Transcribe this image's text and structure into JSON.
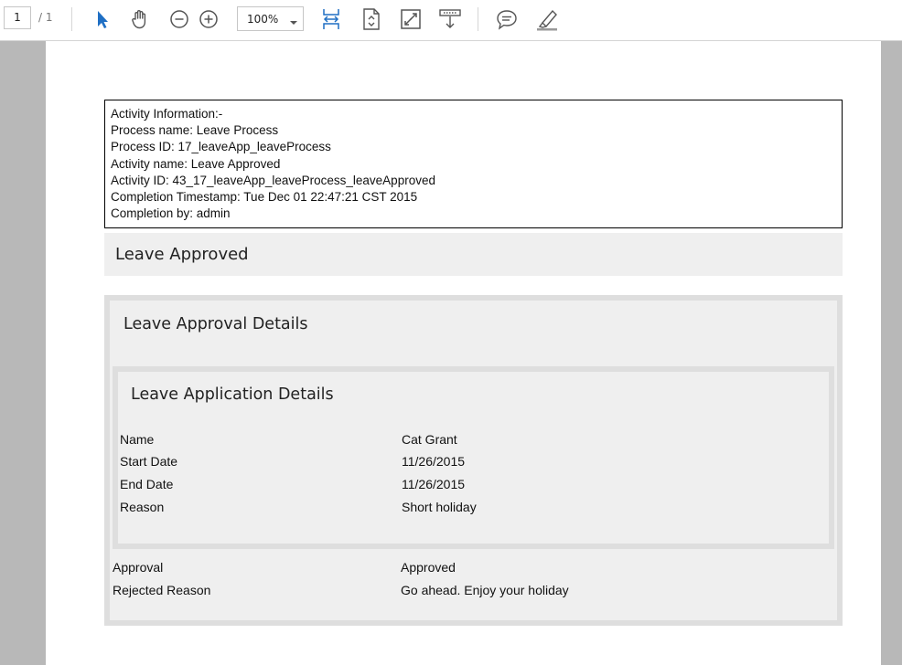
{
  "toolbar": {
    "page_current": "1",
    "page_total": "/ 1",
    "zoom": "100%",
    "icons": [
      "select-arrow-icon",
      "hand-pan-icon",
      "zoom-out-icon",
      "zoom-in-icon",
      "fit-width-icon",
      "fit-page-icon",
      "full-screen-icon",
      "download-icon",
      "comment-icon",
      "highlight-pen-icon"
    ]
  },
  "info": {
    "lines": [
      "Activity Information:-",
      "Process name: Leave Process",
      "Process ID: 17_leaveApp_leaveProcess",
      "Activity name: Leave Approved",
      "Activity ID: 43_17_leaveApp_leaveProcess_leaveApproved",
      "Completion Timestamp: Tue Dec 01 22:47:21 CST 2015",
      "Completion by: admin"
    ]
  },
  "header": {
    "title": "Leave Approved"
  },
  "approval_section": {
    "title": "Leave Approval Details",
    "application_section": {
      "title": "Leave Application Details",
      "fields": [
        {
          "label": "Name",
          "value": "Cat Grant"
        },
        {
          "label": "Start Date",
          "value": "11/26/2015"
        },
        {
          "label": "End Date",
          "value": "11/26/2015"
        },
        {
          "label": "Reason",
          "value": "Short holiday"
        }
      ]
    },
    "fields": [
      {
        "label": "Approval",
        "value": "Approved"
      },
      {
        "label": "Rejected Reason",
        "value": "Go ahead. Enjoy your holiday"
      }
    ]
  }
}
